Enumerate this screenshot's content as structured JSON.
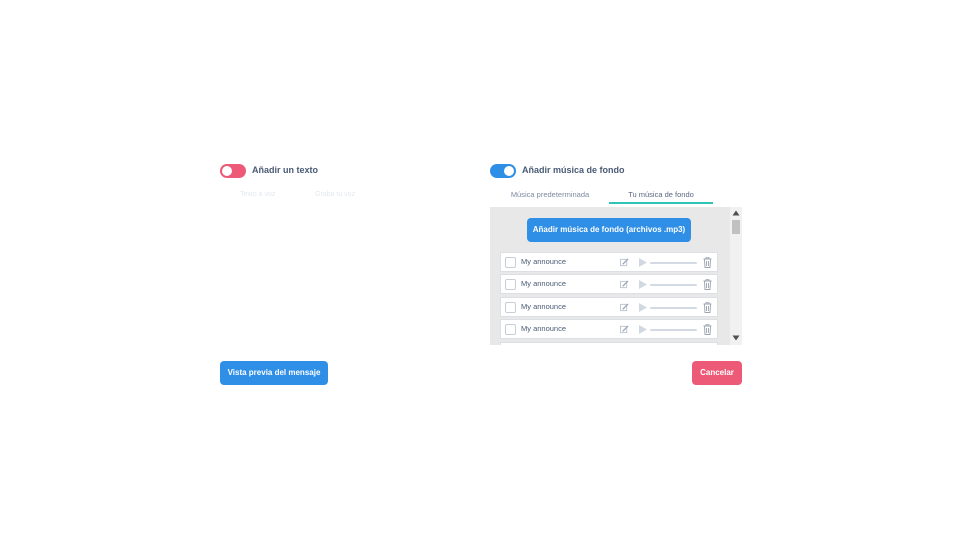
{
  "text_section": {
    "label": "Añadir un texto",
    "toggle_on": false,
    "ghost_tabs": [
      "Texto a voz",
      "Graba tu voz"
    ]
  },
  "music_section": {
    "label": "Añadir música de fondo",
    "toggle_on": true,
    "tabs": [
      {
        "label": "Música predeterminada",
        "active": false
      },
      {
        "label": "Tu música de fondo",
        "active": true
      }
    ],
    "upload_label": "Añadir música de fondo (archivos .mp3)",
    "tracks": [
      {
        "name": "My announce"
      },
      {
        "name": "My announce"
      },
      {
        "name": "My announce"
      },
      {
        "name": "My announce"
      }
    ]
  },
  "footer": {
    "preview_label": "Vista previa del mensaje",
    "cancel_label": "Cancelar"
  },
  "colors": {
    "primary": "#2f8fe6",
    "danger": "#ec5a78",
    "tab_underline": "#2ec4b6"
  }
}
